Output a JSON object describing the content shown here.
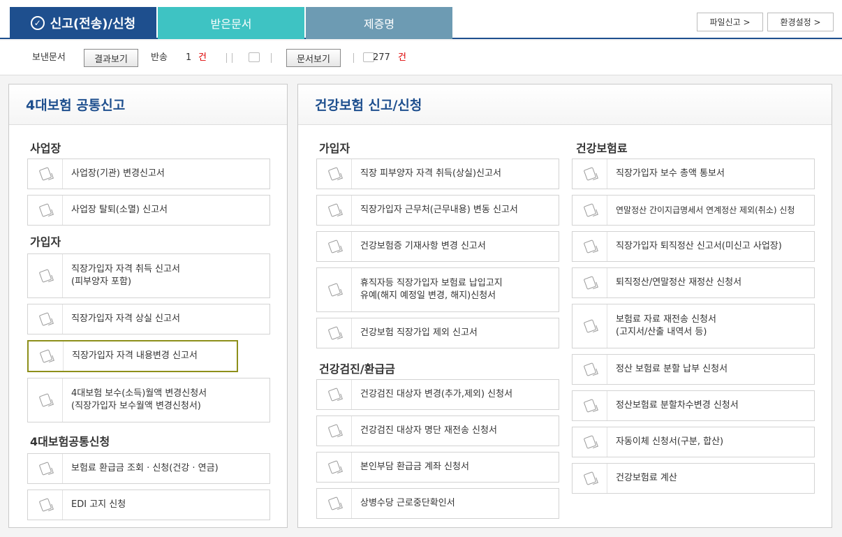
{
  "top": {
    "main_tab": "신고(전송)/신청",
    "received_tab": "받은문서",
    "cert_tab": "제증명",
    "file_report_btn": "파일신고 >",
    "env_settings_btn": "환경설정 >"
  },
  "subbar": {
    "sent_label": "보낸문서",
    "result_btn": "결과보기",
    "return_label": "반송",
    "return_count": "1",
    "unit": "건",
    "doc_btn": "문서보기",
    "doc_count": "277"
  },
  "left": {
    "title": "4대보험 공통신고",
    "sections": [
      {
        "label": "사업장",
        "items": [
          "사업장(기관) 변경신고서",
          "사업장 탈퇴(소멸) 신고서"
        ]
      },
      {
        "label": "가입자",
        "items": [
          "직장가입자 자격 취득 신고서\n(피부양자 포함)",
          "직장가입자 자격 상실 신고서",
          "직장가입자 자격 내용변경 신고서",
          "4대보험 보수(소득)월액 변경신청서\n(직장가입자 보수월액 변경신청서)"
        ]
      },
      {
        "label": "4대보험공통신청",
        "items": [
          "보험료 환급금 조회 · 신청(건강 · 연금)",
          "EDI 고지 신청"
        ]
      }
    ]
  },
  "right": {
    "title": "건강보험 신고/신청",
    "col1": [
      {
        "label": "가입자",
        "items": [
          "직장 피부양자 자격 취득(상실)신고서",
          "직장가입자 근무처(근무내용) 변동 신고서",
          "건강보험증 기재사항 변경 신고서",
          "휴직자등 직장가입자 보험료 납입고지\n유예(해지 예정일 변경, 해지)신청서",
          "건강보험 직장가입 제외 신고서"
        ]
      },
      {
        "label": "건강검진/환급금",
        "items": [
          "건강검진 대상자 변경(추가,제외) 신청서",
          "건강검진 대상자 명단 재전송 신청서",
          "본인부담 환급금 계좌 신청서",
          "상병수당 근로중단확인서"
        ]
      }
    ],
    "col2": [
      {
        "label": "건강보험료",
        "items": [
          "직장가입자 보수 총액 통보서",
          "연말정산 간이지급명세서 연계정산 제외(취소) 신청",
          "직장가입자 퇴직정산 신고서(미신고 사업장)",
          "퇴직정산/연말정산 재정산 신청서",
          "보험료 자료 재전송 신청서\n(고지서/산출 내역서 등)",
          "정산 보험료 분할 납부 신청서",
          "정산보험료 분할차수변경 신청서",
          "자동이체 신청서(구분, 합산)",
          "건강보험료 계산"
        ]
      }
    ]
  }
}
